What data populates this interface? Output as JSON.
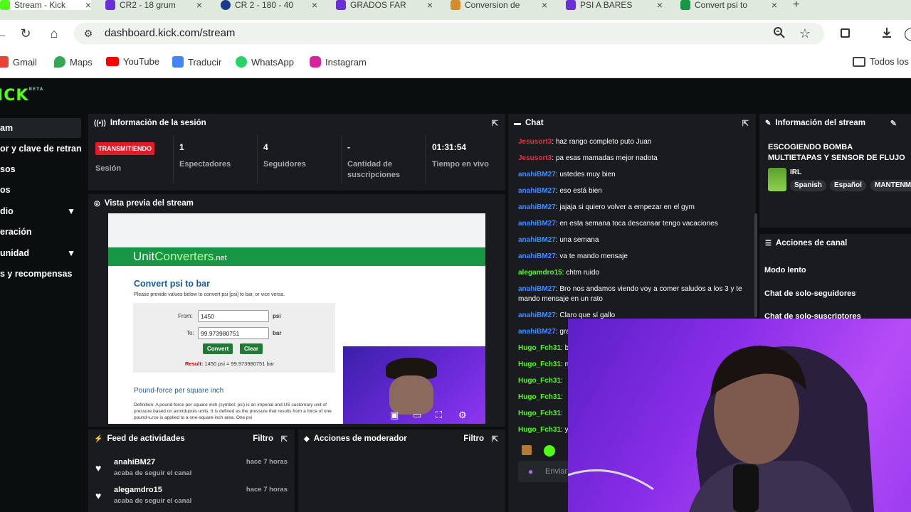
{
  "browser": {
    "tabs": [
      {
        "label": "Stream - Kick",
        "color": "#53fc18"
      },
      {
        "label": "CR2 - 18 grum",
        "color": "#6b2fd6"
      },
      {
        "label": "CR 2 - 180 - 40",
        "color": "#1a3a8a"
      },
      {
        "label": "GRADOS FAR",
        "color": "#6b2fd6"
      },
      {
        "label": "Conversion de",
        "color": "#d38b2d"
      },
      {
        "label": "PSI A BARES",
        "color": "#6b2fd6"
      },
      {
        "label": "Convert psi to",
        "color": "#179646"
      }
    ],
    "url": "dashboard.kick.com/stream",
    "bookmarks": [
      {
        "label": "Gmail",
        "color": "#ea4335"
      },
      {
        "label": "Maps",
        "color": "#34a853"
      },
      {
        "label": "YouTube",
        "color": "#ff0000"
      },
      {
        "label": "Traducir",
        "color": "#4285f4"
      },
      {
        "label": "WhatsApp",
        "color": "#25d366"
      },
      {
        "label": "Instagram",
        "color": "#d6249f"
      }
    ],
    "bookmarks_folder": "Todos los"
  },
  "app": {
    "logo": "KICK",
    "logo_badge": "BETA",
    "accent": "#53fc18",
    "sidebar": [
      {
        "label": "am",
        "active": true,
        "chev": false
      },
      {
        "label": "or y clave de retransm",
        "active": false,
        "chev": false
      },
      {
        "label": "sos",
        "active": false,
        "chev": false
      },
      {
        "label": "os",
        "active": false,
        "chev": false
      },
      {
        "label": "dio",
        "active": false,
        "chev": true
      },
      {
        "label": "eración",
        "active": false,
        "chev": false
      },
      {
        "label": "unidad",
        "active": false,
        "chev": true
      },
      {
        "label": "s y recompensas",
        "active": false,
        "chev": false
      }
    ]
  },
  "session": {
    "title": "Información de la sesión",
    "badge": "TRANSMITIENDO",
    "badge_label": "Sesión",
    "stats": [
      {
        "value": "1",
        "label": "Espectadores"
      },
      {
        "value": "4",
        "label": "Seguidores"
      },
      {
        "value": "-",
        "label": "Cantidad de suscripciones"
      },
      {
        "value": "01:31:54",
        "label": "Tiempo en vivo"
      }
    ]
  },
  "preview": {
    "title": "Vista previa del stream",
    "site_logo_a": "Unit",
    "site_logo_b": "Converters",
    "site_logo_c": ".net",
    "page_title": "Convert psi to bar",
    "page_sub": "Please provide values below to convert psi [psi] to bar, or vice versa.",
    "from_label": "From:",
    "from_value": "1450",
    "from_unit": "psi",
    "to_label": "To:",
    "to_value": "99.973980751",
    "to_unit": "bar",
    "convert_btn": "Convert",
    "clear_btn": "Clear",
    "result_label": "Result:",
    "result_text": "1450 psi = 99.973980751 bar",
    "h2": "Pound-force per square inch",
    "definition": "Definition: A pound-force per square inch (symbol: psi) is an imperial and US customary unit of pressure based on avoirdupois units. It is defined as the pressure that results from a force of one pound-force is applied to a one-square-inch area. One psi"
  },
  "chat": {
    "title": "Chat",
    "messages": [
      {
        "user": "Jesusort3",
        "color": "#e5323c",
        "text": "haz rango completo puto Juan"
      },
      {
        "user": "Jesusort3",
        "color": "#e5323c",
        "text": "pa esas mamadas mejor nadota"
      },
      {
        "user": "anahiBM27",
        "color": "#3f8dff",
        "text": "ustedes muy bien"
      },
      {
        "user": "anahiBM27",
        "color": "#3f8dff",
        "text": "eso está bien"
      },
      {
        "user": "anahiBM27",
        "color": "#3f8dff",
        "text": "jajaja si quiero volver a empezar en el gym"
      },
      {
        "user": "anahiBM27",
        "color": "#3f8dff",
        "text": "en esta semana toca descansar tengo vacaciones"
      },
      {
        "user": "anahiBM27",
        "color": "#3f8dff",
        "text": "una semana"
      },
      {
        "user": "anahiBM27",
        "color": "#3f8dff",
        "text": "va te mando mensaje"
      },
      {
        "user": "alegamdro15",
        "color": "#53fc18",
        "text": "chtm ruido"
      },
      {
        "user": "anahiBM27",
        "color": "#3f8dff",
        "text": "Bro nos andamos viendo voy a comer saludos a los 3 y te mando mensaje en un rato"
      },
      {
        "user": "anahiBM27",
        "color": "#3f8dff",
        "text": "Claro que sí gallo"
      },
      {
        "user": "anahiBM27",
        "color": "#3f8dff",
        "text": "gra"
      },
      {
        "user": "Hugo_Fch31",
        "color": "#53fc18",
        "text": "b"
      },
      {
        "user": "Hugo_Fch31",
        "color": "#53fc18",
        "text": "n"
      },
      {
        "user": "Hugo_Fch31",
        "color": "#53fc18",
        "text": ""
      },
      {
        "user": "Hugo_Fch31",
        "color": "#53fc18",
        "text": ""
      },
      {
        "user": "Hugo_Fch31",
        "color": "#53fc18",
        "text": ""
      },
      {
        "user": "Hugo_Fch31",
        "color": "#53fc18",
        "text": "y"
      }
    ],
    "send_label": "Enviar"
  },
  "stream_info": {
    "title": "Información del stream",
    "stream_title": "ESCOGIENDO BOMBA MULTIETAPAS Y SENSOR DE FLUJO",
    "category": "IRL",
    "tags": [
      "Spanish",
      "Español",
      "MANTENM"
    ]
  },
  "channel_actions": {
    "title": "Acciones de canal",
    "items": [
      "Modo lento",
      "Chat de solo-seguidores",
      "Chat de solo-suscriptores"
    ]
  },
  "feed": {
    "title": "Feed de actividades",
    "filter": "Filtro",
    "items": [
      {
        "name": "anahiBM27",
        "sub": "acaba de seguir el canal",
        "time": "hace 7 horas"
      },
      {
        "name": "alegamdro15",
        "sub": "acaba de seguir el canal",
        "time": "hace 7 horas"
      }
    ]
  },
  "moderator": {
    "title": "Acciones de moderador",
    "filter": "Filtro"
  }
}
